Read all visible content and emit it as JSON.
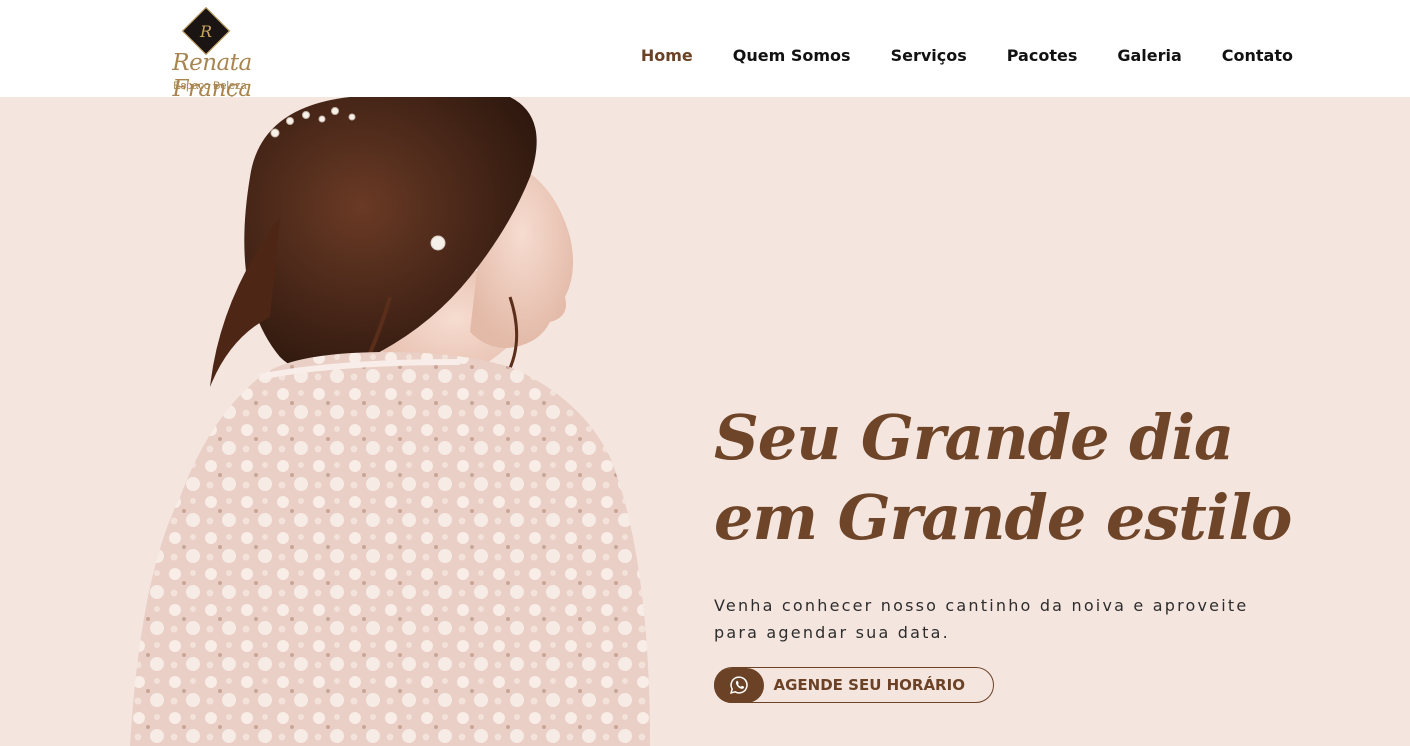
{
  "brand": {
    "monogram": "R",
    "name": "Renata França",
    "tagline": "Espaço Beleza"
  },
  "nav": {
    "items": [
      {
        "label": "Home",
        "active": true
      },
      {
        "label": "Quem Somos",
        "active": false
      },
      {
        "label": "Serviços",
        "active": false
      },
      {
        "label": "Pacotes",
        "active": false
      },
      {
        "label": "Galeria",
        "active": false
      },
      {
        "label": "Contato",
        "active": false
      }
    ]
  },
  "hero": {
    "headline_line1": "Seu Grande dia",
    "headline_line2": "em Grande estilo",
    "description_line1": "Venha conhecer nosso cantinho da noiva e aproveite",
    "description_line2": "para agendar sua data.",
    "cta_label": "AGENDE SEU HORÁRIO",
    "cta_icon": "whatsapp-icon",
    "image_subject": "bride-photo"
  },
  "colors": {
    "background": "#f5e5df",
    "accent": "#6b4226",
    "logo_gold": "#a88550"
  }
}
